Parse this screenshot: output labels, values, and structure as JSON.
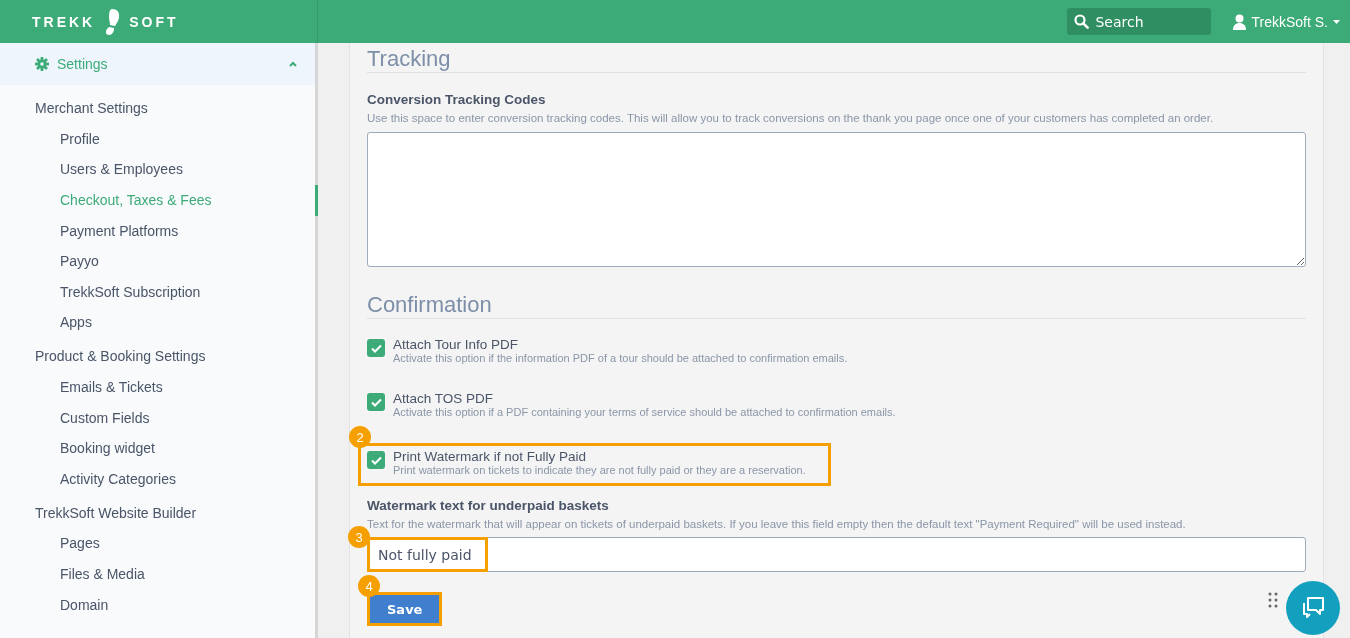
{
  "header": {
    "logo_left": "TREKK",
    "logo_right": "SOFT",
    "search": {
      "placeholder": "Search"
    },
    "user": "TrekkSoft S."
  },
  "sidebar": {
    "section": {
      "label": "Settings",
      "expanded": true
    },
    "groups": [
      {
        "label": "Merchant Settings",
        "items": [
          {
            "label": "Profile",
            "selected": false
          },
          {
            "label": "Users & Employees",
            "selected": false
          },
          {
            "label": "Checkout, Taxes & Fees",
            "selected": true
          },
          {
            "label": "Payment Platforms",
            "selected": false
          },
          {
            "label": "Payyo",
            "selected": false
          },
          {
            "label": "TrekkSoft Subscription",
            "selected": false
          },
          {
            "label": "Apps",
            "selected": false
          }
        ]
      },
      {
        "label": "Product & Booking Settings",
        "items": [
          {
            "label": "Emails & Tickets",
            "selected": false
          },
          {
            "label": "Custom Fields",
            "selected": false
          },
          {
            "label": "Booking widget",
            "selected": false
          },
          {
            "label": "Activity Categories",
            "selected": false
          }
        ]
      },
      {
        "label": "TrekkSoft Website Builder",
        "items": [
          {
            "label": "Pages",
            "selected": false
          },
          {
            "label": "Files & Media",
            "selected": false
          },
          {
            "label": "Domain",
            "selected": false
          }
        ]
      }
    ]
  },
  "tracking": {
    "title": "Tracking",
    "field_label": "Conversion Tracking Codes",
    "help": "Use this space to enter conversion tracking codes. This will allow you to track conversions on the thank you page once one of your customers has completed an order."
  },
  "confirmation": {
    "title": "Confirmation",
    "options": [
      {
        "label": "Attach Tour Info PDF",
        "description": "Activate this option if the information PDF of a tour should be attached to confirmation emails.",
        "checked": true
      },
      {
        "label": "Attach TOS PDF",
        "description": "Activate this option if a PDF containing your terms of service should be attached to confirmation emails.",
        "checked": true
      },
      {
        "label": "Print Watermark if not Fully Paid",
        "description": "Print watermark on tickets to indicate they are not fully paid or they are a reservation.",
        "checked": true,
        "annotation": "2"
      }
    ]
  },
  "watermark": {
    "label": "Watermark text for underpaid baskets",
    "help": "Text for the watermark that will appear on tickets of underpaid baskets. If you leave this field empty then the default text \"Payment Required\" will be used instead.",
    "value": "Not fully paid",
    "annotation": "3"
  },
  "save": {
    "label": "Save",
    "annotation": "4"
  }
}
